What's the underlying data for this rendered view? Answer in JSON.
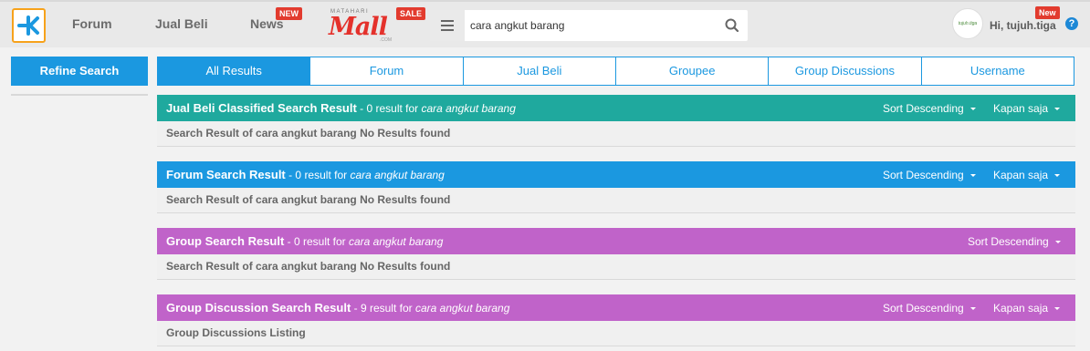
{
  "header": {
    "nav": [
      "Forum",
      "Jual Beli",
      "News"
    ],
    "news_badge": "NEW",
    "mall": {
      "top": "MATAHARI",
      "word": "Mall",
      "com": ".COM",
      "badge": "SALE"
    },
    "search": {
      "value": "cara angkut barang"
    },
    "user": {
      "avatar_text": "tujuh.tiga",
      "greeting": "Hi, tujuh.tiga",
      "badge": "New",
      "help": "?"
    }
  },
  "sidebar": {
    "refine": "Refine Search"
  },
  "tabs": [
    "All Results",
    "Forum",
    "Jual Beli",
    "Groupee",
    "Group Discussions",
    "Username"
  ],
  "results": [
    {
      "title": "Jual Beli Classified Search Result",
      "count": " - 0 result for ",
      "query": "cara angkut barang",
      "sort": "Sort Descending",
      "time": "Kapan saja",
      "body": "Search Result of cara angkut barang No Results found"
    },
    {
      "title": "Forum Search Result",
      "count": " - 0 result for ",
      "query": "cara angkut barang",
      "sort": "Sort Descending",
      "time": "Kapan saja",
      "body": "Search Result of cara angkut barang No Results found"
    },
    {
      "title": "Group Search Result",
      "count": " - 0 result for ",
      "query": "cara angkut barang",
      "sort": "Sort Descending",
      "body": "Search Result of cara angkut barang No Results found"
    },
    {
      "title": "Group Discussion Search Result",
      "count": " - 9 result for ",
      "query": "cara angkut barang",
      "sort": "Sort Descending",
      "time": "Kapan saja",
      "body": "Group Discussions Listing"
    }
  ],
  "colors": {
    "jualbeli": "#1fa99e",
    "forum": "#1b98e0",
    "group": "#c063c9",
    "accent": "#1b98e0"
  }
}
